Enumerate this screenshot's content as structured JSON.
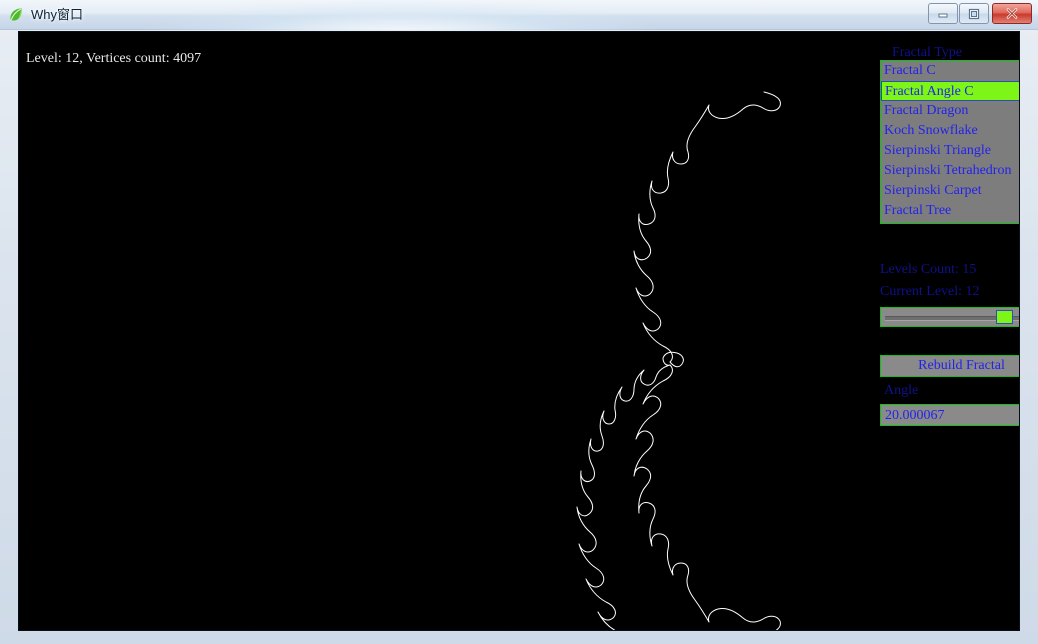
{
  "window": {
    "title": "Why窗口",
    "icon": "leaf-icon",
    "buttons": {
      "minimize": "minimize-icon",
      "maximize": "maximize-icon",
      "close": "close-icon"
    }
  },
  "canvas": {
    "status_text": "Level: 12, Vertices count: 4097",
    "background_color": "#000000",
    "curve_color": "#ffffff"
  },
  "panel": {
    "fractal_type_label": "Fractal Type",
    "fractal_types": [
      "Fractal C",
      "Fractal Angle C",
      "Fractal Dragon",
      "Koch Snowflake",
      "Sierpinski Triangle",
      "Sierpinski Tetrahedron",
      "Sierpinski Carpet",
      "Fractal Tree"
    ],
    "selected_fractal_type": "Fractal Angle C",
    "selected_index": 1,
    "levels_count_label": "Levels Count: 15",
    "current_level_label": "Current Level: 12",
    "slider": {
      "value": 12,
      "min": 0,
      "max": 15,
      "percent": 72
    },
    "rebuild_label": "Rebuild Fractal",
    "angle_label": "Angle",
    "angle_value": "20.000067",
    "accent_color": "#7cf517",
    "text_color": "#2222ee",
    "face_color": "#8a8a8a"
  }
}
